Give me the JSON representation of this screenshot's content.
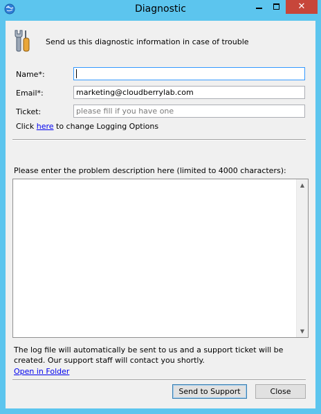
{
  "window": {
    "title": "Diagnostic"
  },
  "header": {
    "text": "Send us this diagnostic information in case of trouble"
  },
  "form": {
    "name_label": "Name*:",
    "name_value": "",
    "email_label": "Email*:",
    "email_value": "marketing@cloudberrylab.com",
    "ticket_label": "Ticket:",
    "ticket_placeholder": "please fill if you have one",
    "logging_prefix": "Click ",
    "logging_link": "here",
    "logging_suffix": " to change Logging Options"
  },
  "description": {
    "label": "Please enter the problem description here (limited to 4000 characters):",
    "value": ""
  },
  "footer": {
    "note": "The log file will automatically be sent to us and a support ticket will be created. Our support staff will contact you shortly.",
    "open_folder": "Open in Folder",
    "send_label": "Send to Support",
    "close_label": "Close"
  }
}
